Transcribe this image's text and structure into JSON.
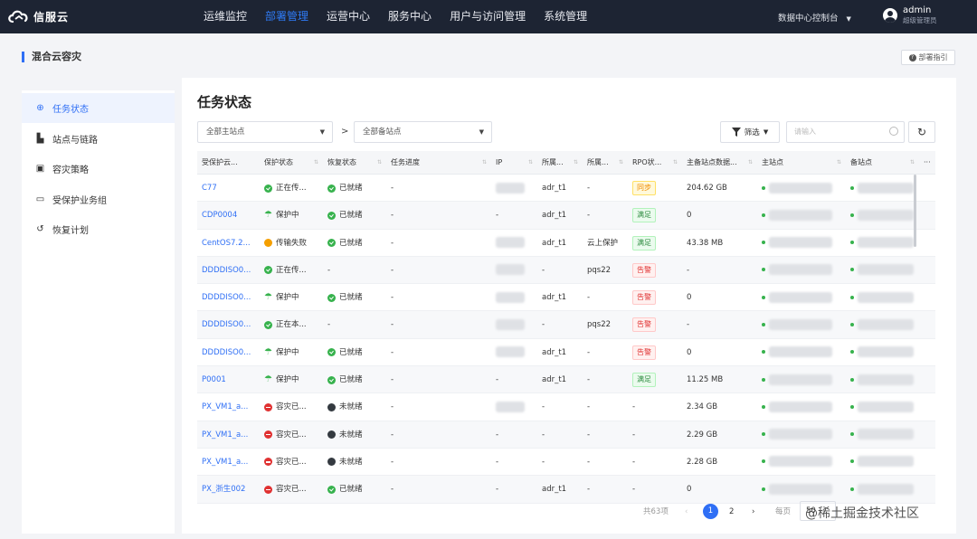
{
  "topbar": {
    "logo_text": "信服云",
    "nav": [
      "运维监控",
      "部署管理",
      "运营中心",
      "服务中心",
      "用户与访问管理",
      "系统管理"
    ],
    "active_nav": "部署管理",
    "datacenter_select": "数据中心控制台",
    "user_name": "admin",
    "user_role": "超级管理员"
  },
  "page": {
    "title": "混合云容灾",
    "guide_label": "部署指引"
  },
  "sidebar": {
    "items": [
      {
        "label": "任务状态",
        "icon": "task-status-icon",
        "active": true
      },
      {
        "label": "站点与链路",
        "icon": "site-link-icon",
        "active": false
      },
      {
        "label": "容灾策略",
        "icon": "policy-icon",
        "active": false
      },
      {
        "label": "受保护业务组",
        "icon": "folder-icon",
        "active": false
      },
      {
        "label": "恢复计划",
        "icon": "recovery-icon",
        "active": false
      }
    ]
  },
  "main": {
    "title": "任务状态",
    "primary_site_select": "全部主站点",
    "separator": ">",
    "backup_site_select": "全部备站点",
    "filter_label": "筛选",
    "search_placeholder": "请输入",
    "columns": [
      "受保护云...",
      "保护状态",
      "恢复状态",
      "任务进度",
      "IP",
      "所属...",
      "所属...",
      "RPO状...",
      "主备站点数据...",
      "主站点",
      "备站点",
      "···"
    ],
    "rows": [
      {
        "name": "C77",
        "protect": {
          "icon": "green",
          "text": "正在传..."
        },
        "recover": {
          "icon": "green",
          "text": "已就绪"
        },
        "progress": "-",
        "ip_blur": true,
        "owner1": "adr_t1",
        "owner2": "-",
        "rpo": {
          "text": "同步",
          "color": "orange"
        },
        "data": "204.62 GB"
      },
      {
        "name": "CDP0004",
        "protect": {
          "icon": "umbrella",
          "text": "保护中"
        },
        "recover": {
          "icon": "green",
          "text": "已就绪"
        },
        "progress": "-",
        "ip_blur": false,
        "ip": "-",
        "owner1": "adr_t1",
        "owner2": "-",
        "rpo": {
          "text": "满足",
          "color": "green"
        },
        "data": "0"
      },
      {
        "name": "CentOS7.2...",
        "protect": {
          "icon": "orange",
          "text": "传输失败"
        },
        "recover": {
          "icon": "green",
          "text": "已就绪"
        },
        "progress": "-",
        "ip_blur": true,
        "owner1": "adr_t1",
        "owner2": "云上保护",
        "rpo": {
          "text": "满足",
          "color": "green"
        },
        "data": "43.38 MB"
      },
      {
        "name": "DDDDISO0...",
        "protect": {
          "icon": "green",
          "text": "正在传..."
        },
        "recover": {
          "icon": "none",
          "text": "-"
        },
        "progress": "-",
        "ip_blur": true,
        "owner1": "-",
        "owner2": "pqs22",
        "rpo": {
          "text": "告警",
          "color": "red"
        },
        "data": "-"
      },
      {
        "name": "DDDDISO0...",
        "protect": {
          "icon": "umbrella",
          "text": "保护中"
        },
        "recover": {
          "icon": "green",
          "text": "已就绪"
        },
        "progress": "-",
        "ip_blur": true,
        "owner1": "adr_t1",
        "owner2": "-",
        "rpo": {
          "text": "告警",
          "color": "red"
        },
        "data": "0"
      },
      {
        "name": "DDDDISO0...",
        "protect": {
          "icon": "green",
          "text": "正在本..."
        },
        "recover": {
          "icon": "none",
          "text": "-"
        },
        "progress": "-",
        "ip_blur": true,
        "owner1": "-",
        "owner2": "pqs22",
        "rpo": {
          "text": "告警",
          "color": "red"
        },
        "data": "-"
      },
      {
        "name": "DDDDISO0...",
        "protect": {
          "icon": "umbrella",
          "text": "保护中"
        },
        "recover": {
          "icon": "green",
          "text": "已就绪"
        },
        "progress": "-",
        "ip_blur": true,
        "owner1": "adr_t1",
        "owner2": "-",
        "rpo": {
          "text": "告警",
          "color": "red"
        },
        "data": "0"
      },
      {
        "name": "P0001",
        "protect": {
          "icon": "umbrella",
          "text": "保护中"
        },
        "recover": {
          "icon": "green",
          "text": "已就绪"
        },
        "progress": "-",
        "ip_blur": false,
        "ip": "-",
        "owner1": "adr_t1",
        "owner2": "-",
        "rpo": {
          "text": "满足",
          "color": "green"
        },
        "data": "11.25 MB"
      },
      {
        "name": "PX_VM1_a...",
        "protect": {
          "icon": "red",
          "text": "容灾已..."
        },
        "recover": {
          "icon": "dark",
          "text": "未就绪"
        },
        "progress": "-",
        "ip_blur": true,
        "owner1": "-",
        "owner2": "-",
        "rpo": {
          "text": "-",
          "color": "none"
        },
        "data": "2.34 GB"
      },
      {
        "name": "PX_VM1_a...",
        "protect": {
          "icon": "red",
          "text": "容灾已..."
        },
        "recover": {
          "icon": "dark",
          "text": "未就绪"
        },
        "progress": "-",
        "ip_blur": false,
        "ip": "-",
        "owner1": "-",
        "owner2": "-",
        "rpo": {
          "text": "-",
          "color": "none"
        },
        "data": "2.29 GB"
      },
      {
        "name": "PX_VM1_a...",
        "protect": {
          "icon": "red",
          "text": "容灾已..."
        },
        "recover": {
          "icon": "dark",
          "text": "未就绪"
        },
        "progress": "-",
        "ip_blur": false,
        "ip": "-",
        "owner1": "-",
        "owner2": "-",
        "rpo": {
          "text": "-",
          "color": "none"
        },
        "data": "2.28 GB"
      },
      {
        "name": "PX_浙生002",
        "protect": {
          "icon": "red",
          "text": "容灾已..."
        },
        "recover": {
          "icon": "green",
          "text": "已就绪"
        },
        "progress": "-",
        "ip_blur": false,
        "ip": "-",
        "owner1": "adr_t1",
        "owner2": "-",
        "rpo": {
          "text": "-",
          "color": "none"
        },
        "data": "0"
      }
    ],
    "pager": {
      "total": "共63项",
      "prev": "‹",
      "pages": [
        "1",
        "2"
      ],
      "current": "1",
      "next": "›",
      "size_label": "每页",
      "size": "50"
    }
  },
  "watermark": "@稀土掘金技术社区",
  "colors": {
    "topbar": "#1d2433",
    "accent": "#2f6ff5",
    "ok": "#37b24d",
    "alarm": "#e03131"
  }
}
